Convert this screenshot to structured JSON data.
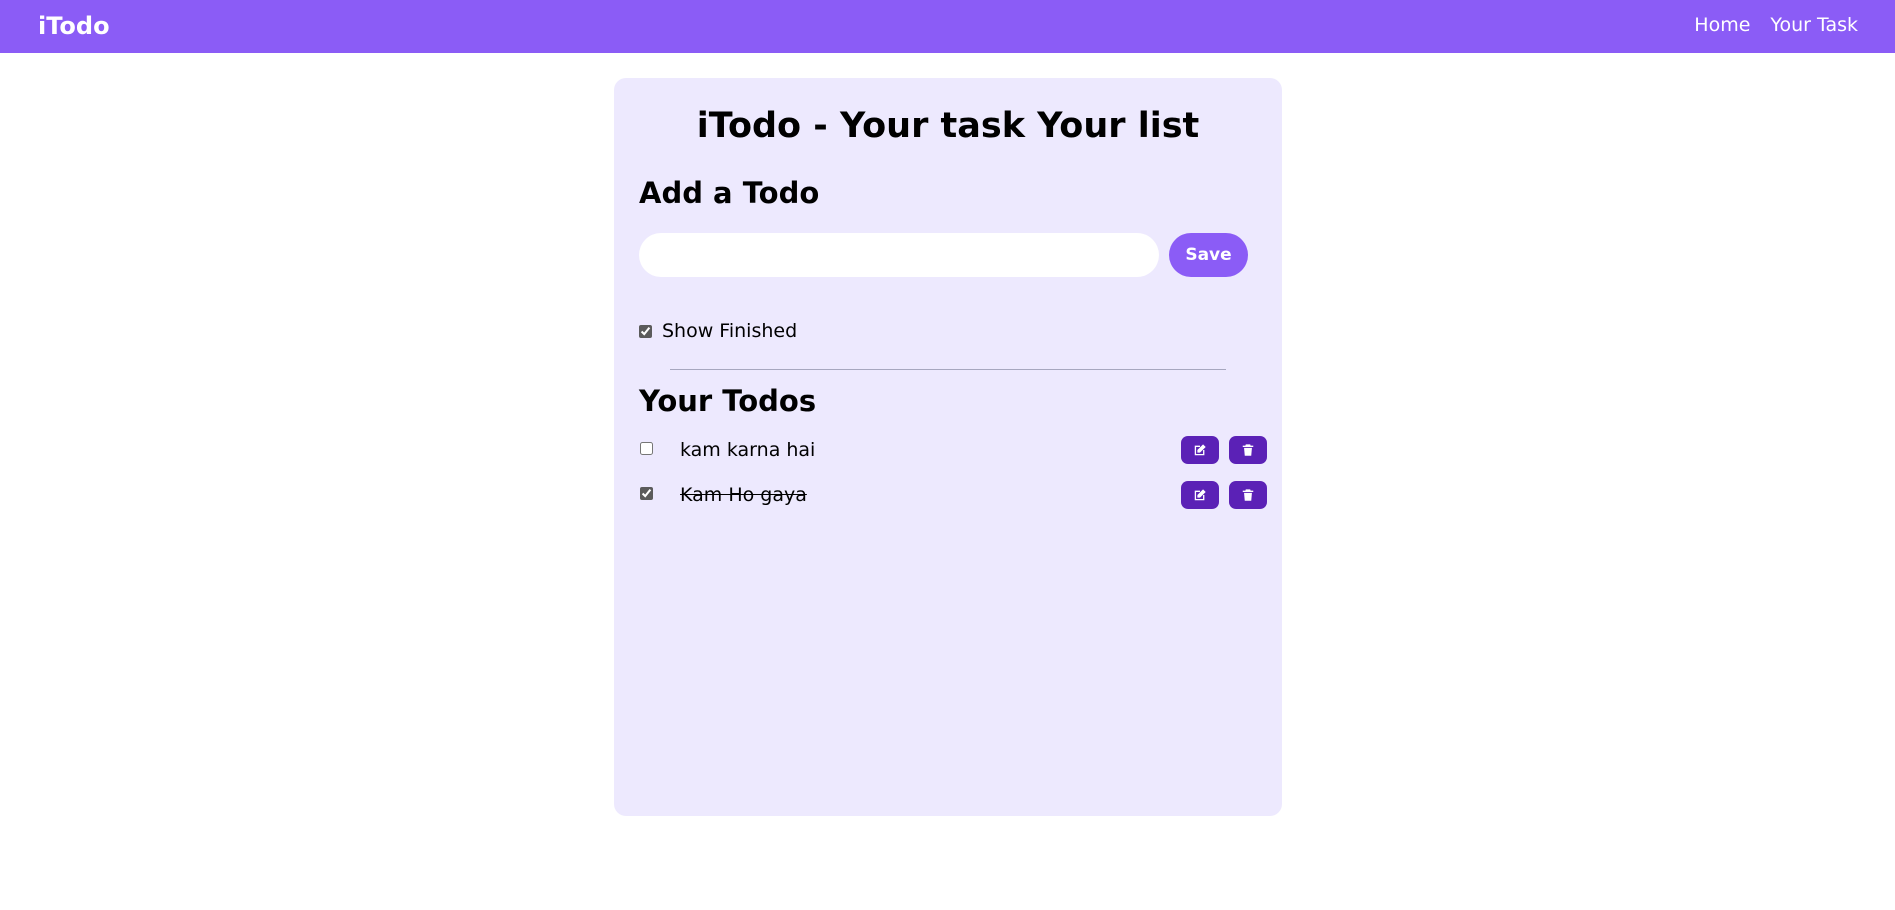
{
  "navbar": {
    "brand": "iTodo",
    "links": [
      "Home",
      "Your Task"
    ],
    "color": "#8b5cf6"
  },
  "card": {
    "background": "#ede9fe",
    "title": "iTodo - Your task Your list"
  },
  "add_section": {
    "title": "Add a Todo",
    "input_value": "",
    "save_label": "Save"
  },
  "filter": {
    "show_finished_label": "Show Finished",
    "show_finished_checked": true
  },
  "todos_section": {
    "title": "Your Todos",
    "items": [
      {
        "text": "kam karna hai",
        "completed": false,
        "edit_icon": "edit-icon",
        "delete_icon": "trash-icon"
      },
      {
        "text": "Kam Ho gaya",
        "completed": true,
        "edit_icon": "edit-icon",
        "delete_icon": "trash-icon"
      }
    ]
  },
  "colors": {
    "accent": "#8b5cf6",
    "action_button": "#5b21b6"
  }
}
